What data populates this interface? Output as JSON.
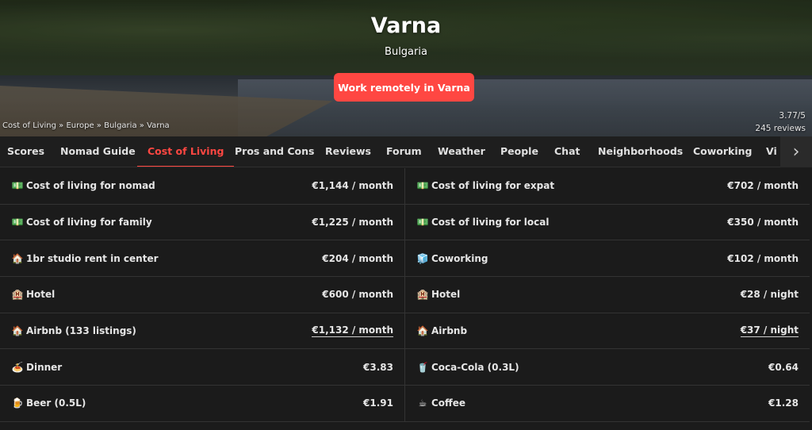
{
  "hero": {
    "city": "Varna",
    "country": "Bulgaria",
    "cta_label": "Work remotely in Varna",
    "breadcrumb": [
      "Cost of Living",
      "Europe",
      "Bulgaria",
      "Varna"
    ],
    "breadcrumb_sep": " » ",
    "rating": "3.77/5",
    "reviews": "245 reviews"
  },
  "tabs": [
    {
      "label": "Scores"
    },
    {
      "label": "Nomad Guide"
    },
    {
      "label": "Cost of Living",
      "active": true
    },
    {
      "label": "Pros and Cons"
    },
    {
      "label": "Reviews"
    },
    {
      "label": "Forum"
    },
    {
      "label": "Weather"
    },
    {
      "label": "People"
    },
    {
      "label": "Chat"
    },
    {
      "label": "Neighborhoods"
    },
    {
      "label": "Coworking"
    },
    {
      "label": "Vi"
    }
  ],
  "next_arrow": "›",
  "costs_left": [
    {
      "icon": "💵",
      "icon_name": "money-icon",
      "label": "Cost of living for nomad",
      "value": "€1,144 / month"
    },
    {
      "icon": "💵",
      "icon_name": "money-icon",
      "label": "Cost of living for family",
      "value": "€1,225 / month"
    },
    {
      "icon": "🏠",
      "icon_name": "house-icon",
      "label": "1br studio rent in center",
      "value": "€204 / month"
    },
    {
      "icon": "🏨",
      "icon_name": "hotel-icon",
      "label": "Hotel",
      "value": "€600 / month"
    },
    {
      "icon": "🏠",
      "icon_name": "house-icon",
      "label": "Airbnb (133 listings)",
      "value": "€1,132 / month",
      "link": true
    },
    {
      "icon": "🍝",
      "icon_name": "dinner-icon",
      "label": "Dinner",
      "value": "€3.83"
    },
    {
      "icon": "🍺",
      "icon_name": "beer-icon",
      "label": "Beer (0.5L)",
      "value": "€1.91"
    }
  ],
  "costs_right": [
    {
      "icon": "💵",
      "icon_name": "money-icon",
      "label": "Cost of living for expat",
      "value": "€702 / month"
    },
    {
      "icon": "💵",
      "icon_name": "money-icon",
      "label": "Cost of living for local",
      "value": "€350 / month"
    },
    {
      "icon": "🧊",
      "icon_name": "coworking-icon",
      "label": "Coworking",
      "value": "€102 / month"
    },
    {
      "icon": "🏨",
      "icon_name": "hotel-icon",
      "label": "Hotel",
      "value": "€28 / night"
    },
    {
      "icon": "🏠",
      "icon_name": "house-icon",
      "label": "Airbnb",
      "value": "€37 / night",
      "link": true
    },
    {
      "icon": "🥤",
      "icon_name": "soda-icon",
      "label": "Coca-Cola (0.3L)",
      "value": "€0.64"
    },
    {
      "icon": "☕",
      "icon_name": "coffee-icon",
      "label": "Coffee",
      "value": "€1.28"
    }
  ],
  "colors": {
    "accent": "#ff4742",
    "background": "#1b1b1b",
    "row_border": "#333333"
  }
}
